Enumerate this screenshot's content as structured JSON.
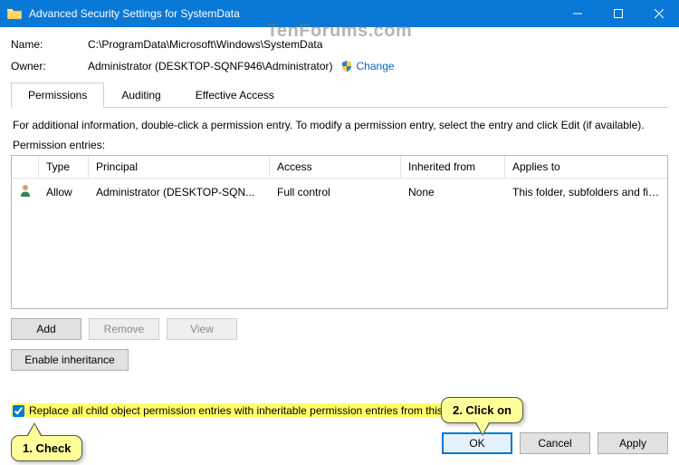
{
  "window": {
    "title": "Advanced Security Settings for SystemData"
  },
  "watermark": "TenForums.com",
  "name_row": {
    "label": "Name:",
    "value": "C:\\ProgramData\\Microsoft\\Windows\\SystemData"
  },
  "owner_row": {
    "label": "Owner:",
    "value": "Administrator (DESKTOP-SQNF946\\Administrator)",
    "change": "Change"
  },
  "tabs": [
    {
      "label": "Permissions",
      "active": true
    },
    {
      "label": "Auditing",
      "active": false
    },
    {
      "label": "Effective Access",
      "active": false
    }
  ],
  "info_text": "For additional information, double-click a permission entry. To modify a permission entry, select the entry and click Edit (if available).",
  "perm_subhead": "Permission entries:",
  "perm_headers": {
    "type": "Type",
    "principal": "Principal",
    "access": "Access",
    "inherited": "Inherited from",
    "applies": "Applies to"
  },
  "perm_rows": [
    {
      "type": "Allow",
      "principal": "Administrator (DESKTOP-SQN...",
      "access": "Full control",
      "inherited": "None",
      "applies": "This folder, subfolders and files"
    }
  ],
  "buttons": {
    "add": "Add",
    "remove": "Remove",
    "view": "View",
    "enable_inh": "Enable inheritance",
    "ok": "OK",
    "cancel": "Cancel",
    "apply": "Apply"
  },
  "checkbox": {
    "label": "Replace all child object permission entries with inheritable permission entries from this object",
    "checked": true
  },
  "callouts": {
    "c1": "1. Check",
    "c2": "2. Click on"
  }
}
